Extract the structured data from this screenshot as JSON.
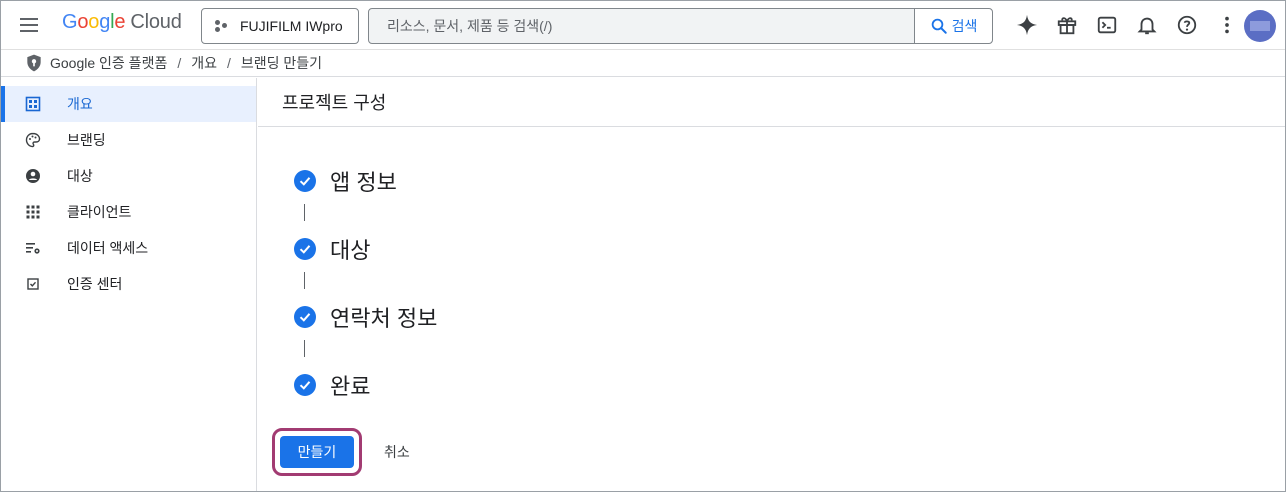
{
  "header": {
    "logo": {
      "letters": [
        "G",
        "o",
        "o",
        "g",
        "l",
        "e"
      ],
      "product": "Cloud"
    },
    "project_name": "FUJIFILM IWpro",
    "search_placeholder": "리소스, 문서, 제품 등 검색(/)",
    "search_button_label": "검색",
    "icons": [
      "gemini-icon",
      "gift-icon",
      "cloud-shell-icon",
      "notifications-icon",
      "help-icon",
      "more-vert-icon"
    ]
  },
  "breadcrumb": {
    "root": "Google 인증 플랫폼",
    "items": [
      "개요",
      "브랜딩 만들기"
    ],
    "separator": "/"
  },
  "sidebar": {
    "items": [
      {
        "label": "개요",
        "icon": "dashboard-icon",
        "active": true
      },
      {
        "label": "브랜딩",
        "icon": "palette-icon",
        "active": false
      },
      {
        "label": "대상",
        "icon": "account-circle-icon",
        "active": false
      },
      {
        "label": "클라이언트",
        "icon": "apps-grid-icon",
        "active": false
      },
      {
        "label": "데이터 액세스",
        "icon": "data-settings-icon",
        "active": false
      },
      {
        "label": "인증 센터",
        "icon": "checkbox-icon",
        "active": false
      }
    ]
  },
  "main": {
    "title": "프로젝트 구성",
    "steps": [
      {
        "label": "앱 정보",
        "status": "complete"
      },
      {
        "label": "대상",
        "status": "complete"
      },
      {
        "label": "연락처 정보",
        "status": "complete"
      },
      {
        "label": "완료",
        "status": "complete"
      }
    ],
    "create_label": "만들기",
    "cancel_label": "취소"
  },
  "colors": {
    "accent": "#1a73e8",
    "active_bg": "#e8f0fe",
    "highlight_border": "#a23b72"
  }
}
